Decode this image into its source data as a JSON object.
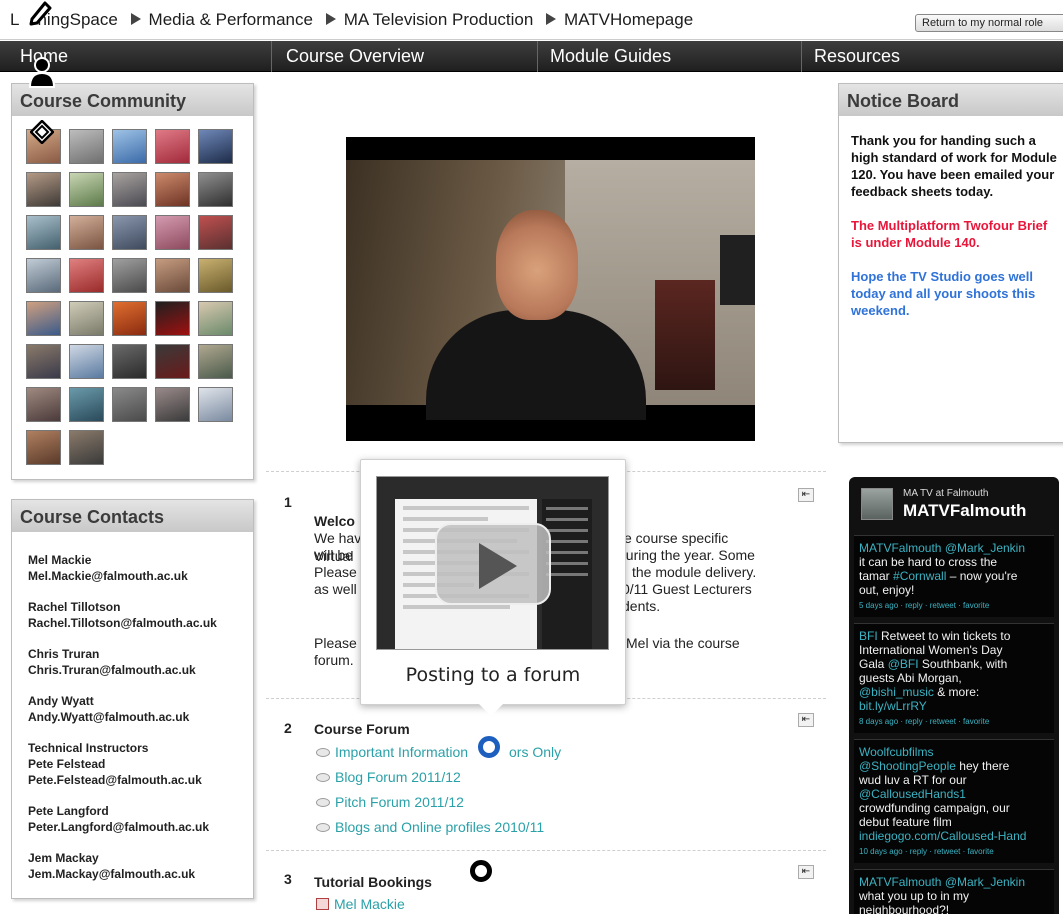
{
  "breadcrumb": {
    "items": [
      "LearningSpace",
      "Media & Performance",
      "MA Television Production",
      "MATVHomepage"
    ],
    "partial_first": "L",
    "partial_rest": "ningSpace"
  },
  "role_button": "Return to my normal role",
  "nav": {
    "items": [
      "Home",
      "Course Overview",
      "Module Guides",
      "Resources"
    ]
  },
  "community": {
    "title": "Course Community",
    "avatar_count": 37
  },
  "contacts": {
    "title": "Course Contacts",
    "people": [
      {
        "name": "Mel Mackie",
        "email": "Mel.Mackie@falmouth.ac.uk"
      },
      {
        "name": "Rachel Tillotson",
        "email": "Rachel.Tillotson@falmouth.ac.uk"
      },
      {
        "name": "Chris Truran",
        "email": "Chris.Truran@falmouth.ac.uk"
      },
      {
        "name": "Andy Wyatt",
        "email": "Andy.Wyatt@falmouth.ac.uk"
      },
      {
        "name": "Technical Instructors",
        "extra": "Pete Felstead",
        "email": "Pete.Felstead@falmouth.ac.uk"
      },
      {
        "name": "Pete Langford",
        "email": "Peter.Langford@falmouth.ac.uk"
      },
      {
        "name": "Jem Mackay",
        "email": "Jem.Mackay@falmouth.ac.uk"
      }
    ]
  },
  "notice_board": {
    "title": "Notice Board",
    "msg1": "Thank you for handing such a high standard of work for Module 120. You have been emailed your feedback sheets today.",
    "msg2": "The Multiplatform Twofour Brief is under Module 140.",
    "msg3": "Hope the TV Studio goes well today and all your shoots this weekend."
  },
  "sections": {
    "s1": {
      "num": "1",
      "title": "Welco",
      "left": [
        "We hav",
        "will be",
        "Please",
        "as well"
      ],
      "right": [
        "e course specific",
        "Virtual",
        "during the year. Some",
        "the module delivery.",
        "0/11 Guest Lecturers",
        "dents."
      ],
      "contact_left": "Please",
      "contact_left2": "forum.",
      "contact_right": "Mel via the course"
    },
    "s2": {
      "num": "2",
      "title": "Course Forum",
      "links": [
        "Important Information",
        "ors Only",
        "Blog Forum 2011/12",
        "Pitch Forum 2011/12",
        "Blogs and Online profiles 2010/11"
      ]
    },
    "s3": {
      "num": "3",
      "title": "Tutorial Bookings",
      "link": "Mel Mackie"
    }
  },
  "popup": {
    "caption": "Posting to a forum"
  },
  "twitter": {
    "sub": "MA TV at Falmouth",
    "name": "MATVFalmouth",
    "tweets": [
      {
        "user": "MATVFalmouth",
        "mention": "@Mark_Jenkin",
        "text1": "it can be hard to cross the",
        "text2": "tamar",
        "tag": "#Cornwall",
        "text3": "– now you're",
        "text4": "out, enjoy!",
        "meta": "5 days ago · reply · retweet · favorite"
      },
      {
        "user": "BFI",
        "text1": "Retweet to win tickets to",
        "text2": "International Women's Day",
        "text3": "Gala",
        "mention": "@BFI",
        "text4": "Southbank, with",
        "text5": "guests Abi Morgan,",
        "mention2": "@bishi_music",
        "text6": "& more:",
        "link": "bit.ly/wLrrRY",
        "meta": "8 days ago · reply · retweet · favorite"
      },
      {
        "user": "Woolfcubfilms",
        "mention": "@ShootingPeople",
        "text1": "hey there",
        "text2": "wud luv a RT for our",
        "mention2": "@CallousedHands1",
        "text3": "crowdfunding campaign, our",
        "text4": "debut feature film",
        "link": "indiegogo.com/Calloused-Hand",
        "meta": "10 days ago · reply · retweet · favorite"
      },
      {
        "user": "MATVFalmouth",
        "mention": "@Mark_Jenkin",
        "text1": "what you up to in my",
        "text2": "neighbourhood?!"
      }
    ]
  }
}
